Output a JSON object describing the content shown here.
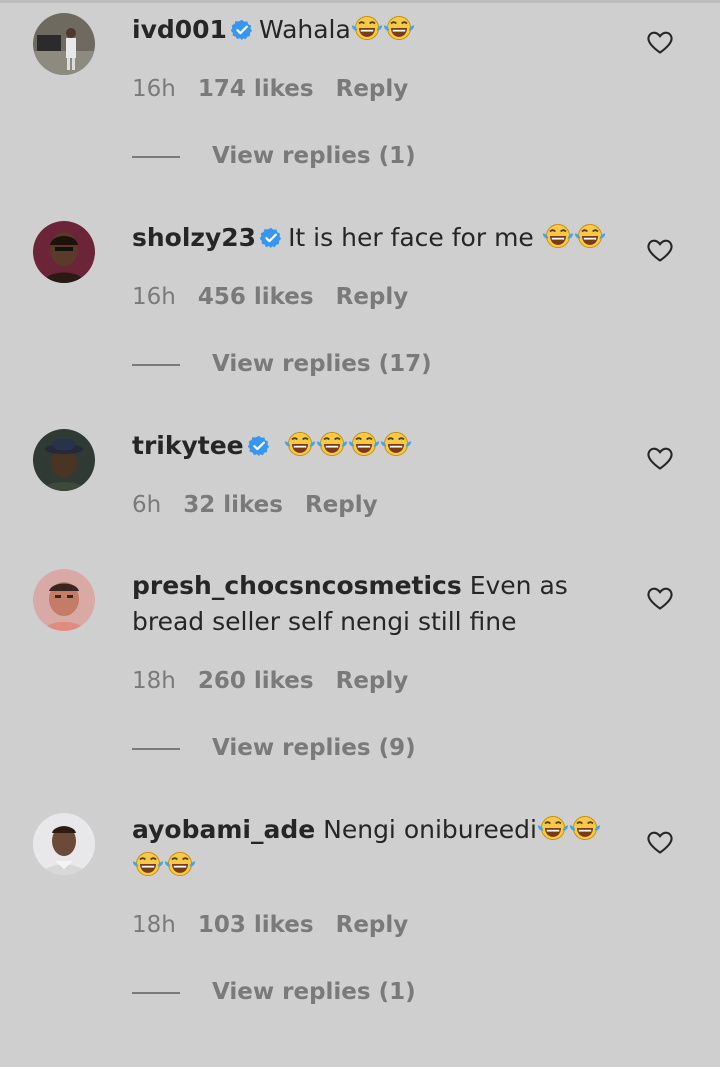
{
  "colors": {
    "background": "#cfcfcf",
    "text": "#262626",
    "muted": "#7a7a7a",
    "verified": "#3797f0"
  },
  "icons": {
    "verified": "verified-badge-icon",
    "like": "heart-icon",
    "emoji": "tears-of-joy-emoji"
  },
  "comments": [
    {
      "username": "ivd001",
      "verified": true,
      "text": "Wahala",
      "emoji_count": 2,
      "time": "16h",
      "likes": "174 likes",
      "reply": "Reply",
      "view_replies": "View replies (1)"
    },
    {
      "username": "sholzy23",
      "verified": true,
      "text": "It is her face for me ",
      "emoji_count": 2,
      "time": "16h",
      "likes": "456 likes",
      "reply": "Reply",
      "view_replies": "View replies (17)"
    },
    {
      "username": "trikytee",
      "verified": true,
      "text": "",
      "emoji_count": 4,
      "time": "6h",
      "likes": "32 likes",
      "reply": "Reply",
      "view_replies": ""
    },
    {
      "username": "presh_chocsncosmetics",
      "verified": false,
      "text": "Even as bread seller self nengi still fine",
      "emoji_count": 0,
      "time": "18h",
      "likes": "260 likes",
      "reply": "Reply",
      "view_replies": "View replies (9)"
    },
    {
      "username": "ayobami_ade",
      "verified": false,
      "text": "Nengi onibureedi",
      "emoji_count": 4,
      "time": "18h",
      "likes": "103 likes",
      "reply": "Reply",
      "view_replies": "View replies (1)"
    }
  ]
}
